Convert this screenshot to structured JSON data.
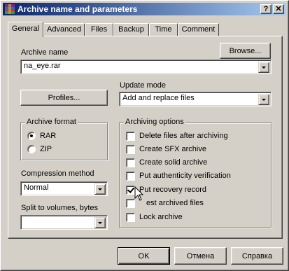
{
  "window": {
    "title": "Archive name and parameters",
    "help_button": "?",
    "close_button": "✕"
  },
  "tabs": [
    {
      "label": "General",
      "active": true
    },
    {
      "label": "Advanced"
    },
    {
      "label": "Files"
    },
    {
      "label": "Backup"
    },
    {
      "label": "Time"
    },
    {
      "label": "Comment"
    }
  ],
  "archive_name": {
    "label": "Archive name",
    "value": "na_eye.rar",
    "browse_label": "Browse..."
  },
  "profiles_label": "Profiles...",
  "update_mode": {
    "label": "Update mode",
    "value": "Add and replace files"
  },
  "archive_format": {
    "label": "Archive format",
    "options": [
      {
        "label": "RAR",
        "selected": true
      },
      {
        "label": "ZIP",
        "selected": false
      }
    ]
  },
  "compression": {
    "label": "Compression method",
    "value": "Normal"
  },
  "split": {
    "label": "Split to volumes, bytes",
    "value": ""
  },
  "archiving_options": {
    "label": "Archiving options",
    "items": [
      {
        "label": "Delete files after archiving",
        "checked": false
      },
      {
        "label": "Create SFX archive",
        "checked": false
      },
      {
        "label": "Create solid archive",
        "checked": false
      },
      {
        "label": "Put authenticity verification",
        "checked": false
      },
      {
        "label": "Put recovery record",
        "checked": true
      },
      {
        "label": "est archived files",
        "checked": false
      },
      {
        "label": "Lock archive",
        "checked": false
      }
    ]
  },
  "footer": {
    "ok_label": "OK",
    "cancel_label": "Отмена",
    "help_label": "Справка"
  },
  "colors": {
    "title_start": "#0a246a",
    "title_end": "#a6caf0",
    "face": "#d4d0c8"
  }
}
